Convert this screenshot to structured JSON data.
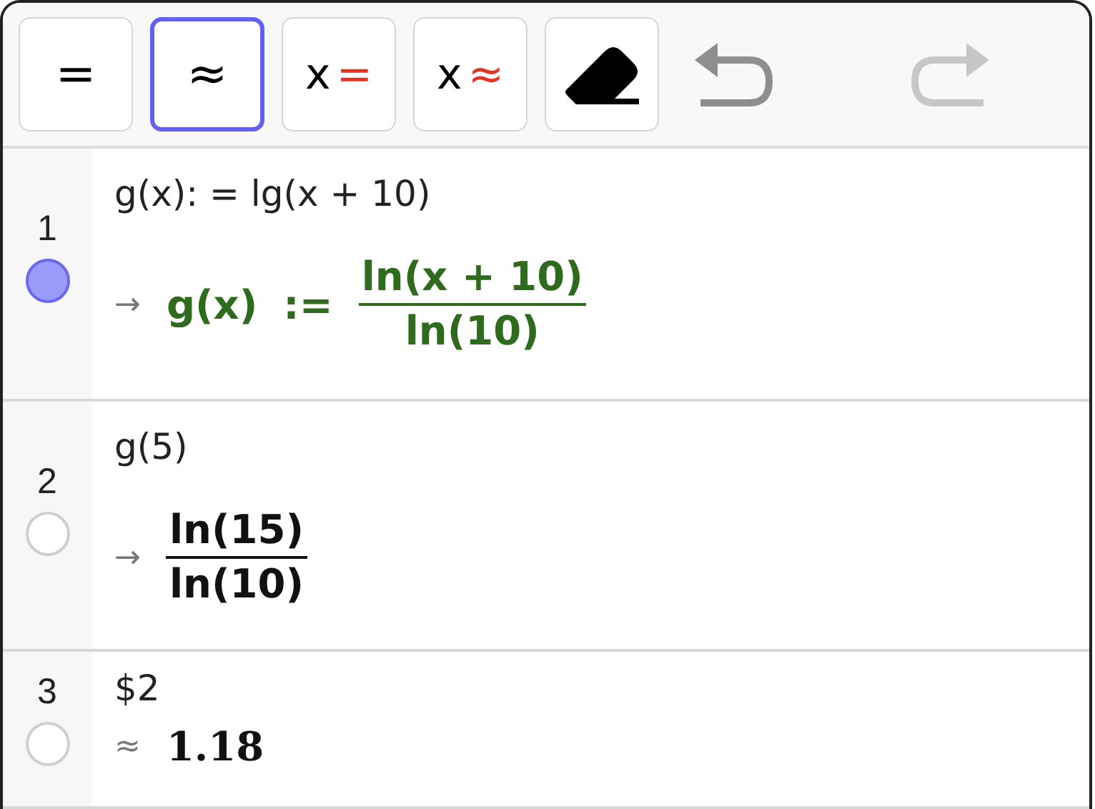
{
  "toolbar": {
    "buttons": [
      {
        "kind": "symbol",
        "label": "=",
        "selected": false
      },
      {
        "kind": "symbol",
        "label": "≈",
        "selected": true
      },
      {
        "kind": "solve",
        "prefix": "x",
        "label": "=",
        "selected": false
      },
      {
        "kind": "solve",
        "prefix": "x",
        "label": "≈",
        "selected": false
      },
      {
        "kind": "eraser",
        "selected": false
      }
    ],
    "undo": {
      "disabled": false
    },
    "redo": {
      "disabled": true
    }
  },
  "rows": [
    {
      "number": "1",
      "visible": true,
      "input": "g(x): = lg(x + 10)",
      "output": {
        "kind": "definition",
        "symbol": "→",
        "lhs": "g(x)",
        "op": ":=",
        "numerator": "ln(x + 10)",
        "denominator": "ln(10)",
        "color": "#2f6b1c"
      }
    },
    {
      "number": "2",
      "visible": false,
      "input": "g(5)",
      "output": {
        "kind": "fraction",
        "symbol": "→",
        "numerator": "ln(15)",
        "denominator": "ln(10)",
        "color": "#111111"
      }
    },
    {
      "number": "3",
      "visible": false,
      "input": "$2",
      "output": {
        "kind": "value",
        "symbol": "≈",
        "value": "1.18",
        "color": "#111111"
      }
    }
  ]
}
